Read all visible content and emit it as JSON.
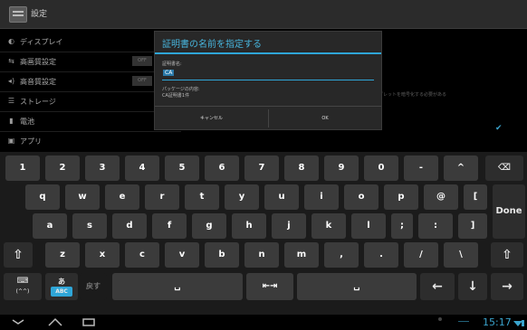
{
  "app": {
    "title": "設定"
  },
  "settings": {
    "items": [
      {
        "label": "ディスプレイ",
        "icon": "◐"
      },
      {
        "label": "高画質設定",
        "icon": "⇆",
        "switch": "OFF"
      },
      {
        "label": "高音質設定",
        "icon": "◂)",
        "switch": "OFF"
      },
      {
        "label": "ストレージ",
        "icon": "☰"
      },
      {
        "label": "電池",
        "icon": "▮"
      },
      {
        "label": "アプリ",
        "icon": "▣"
      }
    ],
    "right_text": "ブレットを暗号化する必要がある"
  },
  "dialog": {
    "title": "証明書の名前を指定する",
    "cert_name_label": "証明書名:",
    "cert_name_value": "CA",
    "package_label": "パッケージの内容:",
    "package_value": "CA証明書1件",
    "cancel": "キャンセル",
    "ok": "OK"
  },
  "keyboard": {
    "row1": [
      "1",
      "2",
      "3",
      "4",
      "5",
      "6",
      "7",
      "8",
      "9",
      "0",
      "-",
      "^"
    ],
    "row2": [
      "q",
      "w",
      "e",
      "r",
      "t",
      "y",
      "u",
      "i",
      "o",
      "p",
      "@",
      "["
    ],
    "row3": [
      "a",
      "s",
      "d",
      "f",
      "g",
      "h",
      "j",
      "k",
      "l",
      ";",
      ":",
      "]"
    ],
    "row4": [
      "z",
      "x",
      "c",
      "v",
      "b",
      "n",
      "m",
      ",",
      ".",
      "/",
      "\\"
    ],
    "backspace": "⌫",
    "done": "Done",
    "shift": "⇧",
    "emoji_label": "(^^)",
    "kana_abc_top": "あ",
    "kana_abc_bottom": "ABC",
    "modoshi": "戻す",
    "space": "␣",
    "convert": "⇤⇥",
    "left_arrow": "←",
    "down_arrow": "↓",
    "right_arrow": "→"
  },
  "status": {
    "time": "15:17"
  }
}
